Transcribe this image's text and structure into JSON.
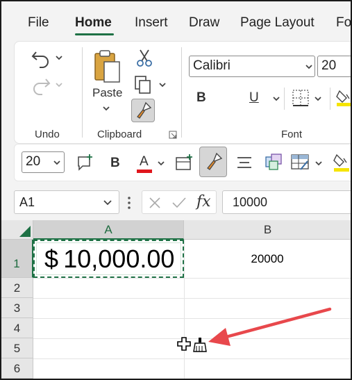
{
  "menu": {
    "tabs": [
      {
        "label": "File"
      },
      {
        "label": "Home"
      },
      {
        "label": "Insert"
      },
      {
        "label": "Draw"
      },
      {
        "label": "Page Layout"
      },
      {
        "label": "Fo"
      }
    ],
    "active": "Home"
  },
  "ribbon": {
    "undo_group_label": "Undo",
    "clipboard_group_label": "Clipboard",
    "font_group_label": "Font",
    "paste_label": "Paste",
    "font_name": "Calibri",
    "font_size": "20",
    "bold_label": "B",
    "underline_label": "U"
  },
  "mini_toolbar": {
    "font_size": "20",
    "bold_label": "B",
    "font_color_label": "A"
  },
  "formula_bar": {
    "name_box": "A1",
    "fx_label": "fx",
    "value": "10000"
  },
  "sheet": {
    "columns": [
      "A",
      "B"
    ],
    "rows": [
      "1",
      "2",
      "3",
      "4",
      "5",
      "6"
    ],
    "cells": {
      "A1": "$ 10,000.00",
      "B1": "20000"
    }
  },
  "colors": {
    "accent_green": "#1e7145",
    "font_color_red": "#e0161d",
    "highlight_yellow": "#f5e400",
    "arrow_red": "#e8484c"
  }
}
